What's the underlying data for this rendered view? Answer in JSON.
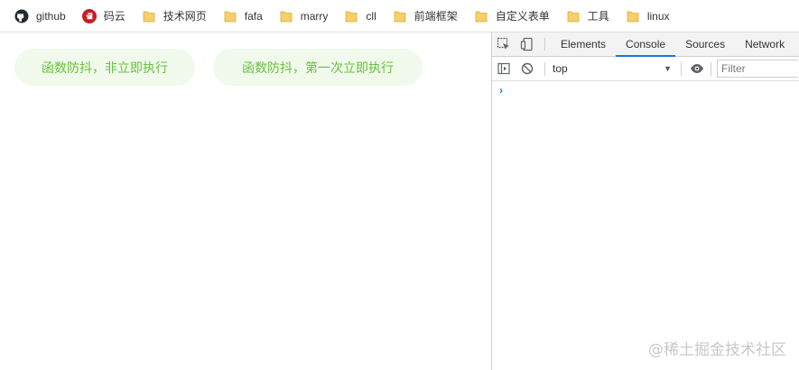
{
  "bookmarks": [
    {
      "label": "github",
      "icon": "github-icon"
    },
    {
      "label": "码云",
      "icon": "gitee-icon"
    },
    {
      "label": "技术网页",
      "icon": "folder-icon"
    },
    {
      "label": "fafa",
      "icon": "folder-icon"
    },
    {
      "label": "marry",
      "icon": "folder-icon"
    },
    {
      "label": "cll",
      "icon": "folder-icon"
    },
    {
      "label": "前端框架",
      "icon": "folder-icon"
    },
    {
      "label": "自定义表单",
      "icon": "folder-icon"
    },
    {
      "label": "工具",
      "icon": "folder-icon"
    },
    {
      "label": "linux",
      "icon": "folder-icon"
    }
  ],
  "page": {
    "button1": "函数防抖，非立即执行",
    "button2": "函数防抖，第一次立即执行"
  },
  "devtools": {
    "tabs": [
      "Elements",
      "Console",
      "Sources",
      "Network"
    ],
    "active_tab": "Console",
    "context": "top",
    "filter_placeholder": "Filter",
    "prompt": "›"
  },
  "watermark": "@稀土掘金技术社区",
  "colors": {
    "pill_bg": "#f0f9eb",
    "pill_text": "#67c23a",
    "folder": "#f5cf6b",
    "gitee": "#c71d23",
    "active_tab_underline": "#1a73e8"
  }
}
